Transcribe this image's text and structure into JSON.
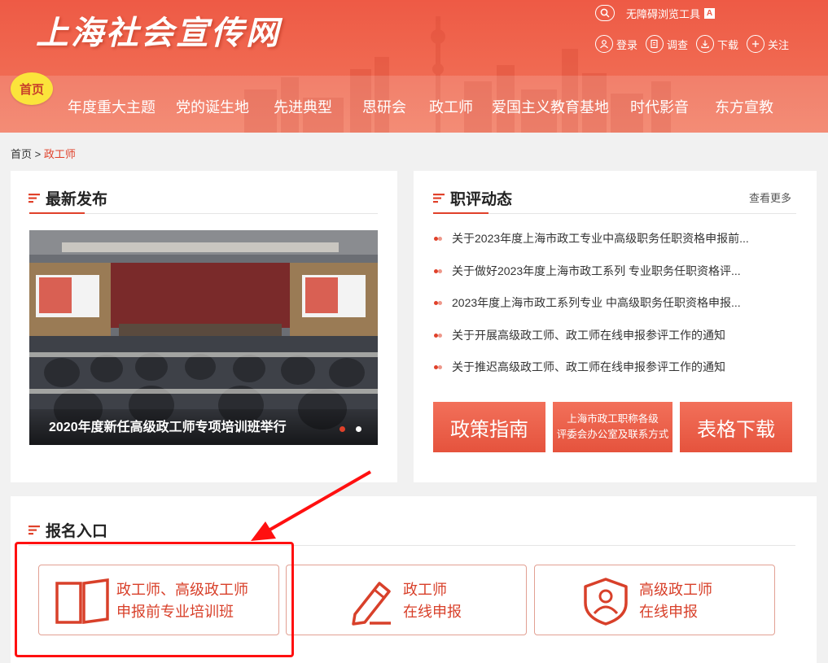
{
  "site": {
    "logo": "上海社会宣传网"
  },
  "accessibility": {
    "label": "无障碍浏览工具",
    "badge": "A"
  },
  "top_links": [
    {
      "label": "登录",
      "icon": "user-icon"
    },
    {
      "label": "调查",
      "icon": "survey-icon"
    },
    {
      "label": "下载",
      "icon": "download-icon"
    },
    {
      "label": "关注",
      "icon": "plus-icon"
    }
  ],
  "nav": {
    "home": "首页",
    "items": [
      "年度重大主题",
      "党的诞生地",
      "先进典型",
      "思研会",
      "政工师",
      "爱国主义教育基地",
      "时代影音",
      "东方宣教"
    ]
  },
  "breadcrumb": {
    "home": "首页",
    "separator": ">",
    "current": "政工师"
  },
  "latest": {
    "title": "最新发布",
    "caption": "2020年度新任高级政工师专项培训班举行"
  },
  "news": {
    "title": "职评动态",
    "more": "查看更多",
    "items": [
      "关于2023年度上海市政工专业中高级职务任职资格申报前...",
      "关于做好2023年度上海市政工系列 专业职务任职资格评...",
      "2023年度上海市政工系列专业 中高级职务任职资格申报...",
      "关于开展高级政工师、政工师在线申报参评工作的通知",
      "关于推迟高级政工师、政工师在线申报参评工作的通知"
    ]
  },
  "quick_buttons": {
    "policy": "政策指南",
    "contact_line1": "上海市政工职称各级",
    "contact_line2": "评委会办公室及联系方式",
    "forms": "表格下载"
  },
  "signup": {
    "title": "报名入口",
    "entries": [
      {
        "line1": "政工师、高级政工师",
        "line2": "申报前专业培训班",
        "icon": "book-icon"
      },
      {
        "line1": "政工师",
        "line2": "在线申报",
        "icon": "pencil-icon"
      },
      {
        "line1": "高级政工师",
        "line2": "在线申报",
        "icon": "shield-user-icon"
      }
    ]
  },
  "colors": {
    "brand": "#ee5a45",
    "accent_red": "#e0412a",
    "home_badge": "#fbe43b",
    "annotation": "#ff1010"
  }
}
